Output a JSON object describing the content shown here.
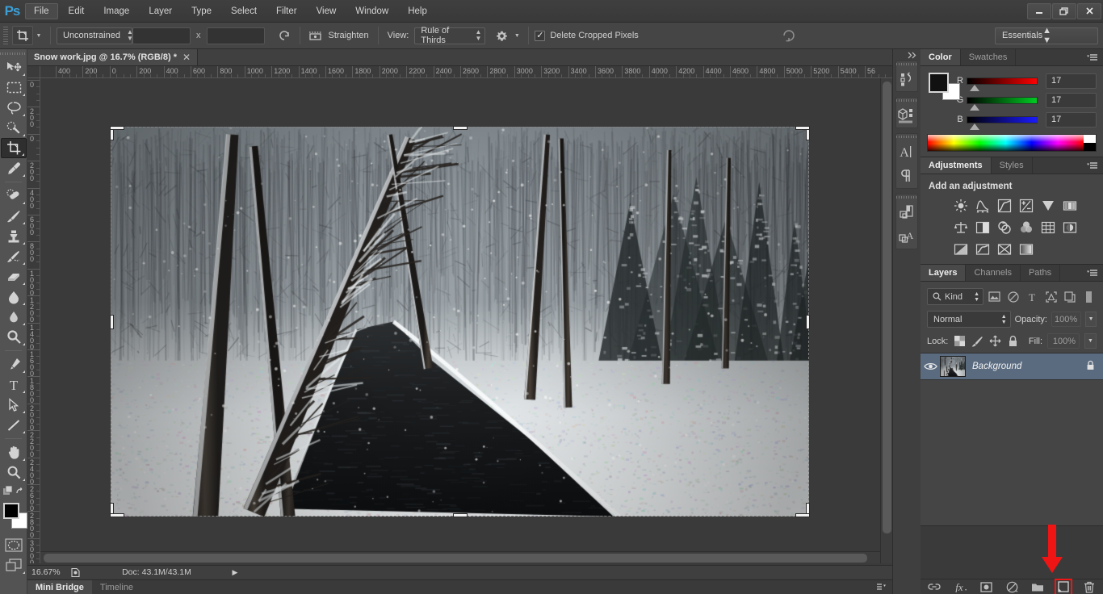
{
  "app": {
    "name": "Ps",
    "logo_color": "#3c9fd6"
  },
  "titlebar": {
    "menus": [
      "File",
      "Edit",
      "Image",
      "Layer",
      "Type",
      "Select",
      "Filter",
      "View",
      "Window",
      "Help"
    ],
    "active_menu": "File",
    "window_buttons": {
      "minimize": "—",
      "restore": "❐",
      "close": "✕"
    }
  },
  "options_bar": {
    "tool_icon": "crop-tool-icon",
    "ratio_preset": "Unconstrained",
    "width_value": "",
    "height_value": "",
    "swap_icon": "swap-arrows-icon",
    "straighten_icon": "straighten-icon",
    "straighten_label": "Straighten",
    "view_label": "View:",
    "overlay_preset": "Rule of Thirds",
    "settings_icon": "gear-icon",
    "delete_cropped_label": "Delete Cropped Pixels",
    "delete_cropped_checked": "✓",
    "reset_icon": "reset-icon",
    "workspace": "Essentials"
  },
  "toolbar": {
    "tools": [
      {
        "name": "move-tool",
        "selected": false
      },
      {
        "name": "rectangular-marquee-tool",
        "selected": false
      },
      {
        "name": "lasso-tool",
        "selected": false
      },
      {
        "name": "quick-selection-tool",
        "selected": false
      },
      {
        "name": "crop-tool",
        "selected": true
      },
      {
        "name": "eyedropper-tool",
        "selected": false
      },
      {
        "name": "spot-healing-brush-tool",
        "selected": false
      },
      {
        "name": "brush-tool",
        "selected": false
      },
      {
        "name": "clone-stamp-tool",
        "selected": false
      },
      {
        "name": "history-brush-tool",
        "selected": false
      },
      {
        "name": "eraser-tool",
        "selected": false
      },
      {
        "name": "gradient-tool",
        "selected": false
      },
      {
        "name": "blur-tool",
        "selected": false
      },
      {
        "name": "dodge-tool",
        "selected": false
      },
      {
        "name": "pen-tool",
        "selected": false
      },
      {
        "name": "horizontal-type-tool",
        "selected": false
      },
      {
        "name": "path-selection-tool",
        "selected": false
      },
      {
        "name": "line-shape-tool",
        "selected": false
      },
      {
        "name": "hand-tool",
        "selected": false
      },
      {
        "name": "zoom-tool",
        "selected": false
      }
    ],
    "foreground_color": "#000000",
    "background_color": "#ffffff"
  },
  "document": {
    "tab_title": "Snow work.jpg @ 16.7% (RGB/8) *",
    "close_glyph": "✕"
  },
  "rulers": {
    "horizontal_labels": [
      "400",
      "200",
      "0",
      "200",
      "400",
      "600",
      "800",
      "1000",
      "1200",
      "1400",
      "1600",
      "1800",
      "2000",
      "2200",
      "2400",
      "2600",
      "2800",
      "3000",
      "3200",
      "3400",
      "3600",
      "3800",
      "4000",
      "4200",
      "4400",
      "4600",
      "4800",
      "5000",
      "5200",
      "5400",
      "56"
    ],
    "vertical_labels": [
      "0",
      "200",
      "0",
      "200",
      "400",
      "600",
      "800",
      "1000",
      "1200",
      "1400",
      "1600",
      "1800",
      "2000",
      "2200",
      "2400",
      "2600",
      "2800",
      "3000",
      "3"
    ],
    "unit": "px"
  },
  "status_bar": {
    "zoom": "16.67%",
    "doc_icon": "document-icon",
    "doc_size": "Doc: 43.1M/43.1M",
    "arrow": "▶"
  },
  "bottom_tabs": {
    "items": [
      {
        "label": "Mini Bridge",
        "active": true
      },
      {
        "label": "Timeline",
        "active": false
      }
    ],
    "menu_icon": "panel-menu-icon"
  },
  "icon_dock": {
    "collapse_icon": "collapse-to-icons-icon",
    "groups": [
      {
        "icons": [
          "history-icon",
          "actions-icon"
        ]
      },
      {
        "icons": [
          "3d-icon",
          "measurement-log-icon"
        ]
      },
      {
        "icons": [
          "character-icon",
          "paragraph-icon"
        ]
      },
      {
        "icons": [
          "layer-comps-icon",
          "character-styles-icon"
        ]
      }
    ]
  },
  "color_panel": {
    "tabs": [
      {
        "label": "Color",
        "active": true
      },
      {
        "label": "Swatches",
        "active": false
      }
    ],
    "menu_icon": "panel-menu-icon",
    "channels": [
      {
        "label": "R",
        "value": "17",
        "from": "#000000",
        "to": "#ff0000"
      },
      {
        "label": "G",
        "value": "17",
        "from": "#000000",
        "to": "#00cc22"
      },
      {
        "label": "B",
        "value": "17",
        "from": "#000000",
        "to": "#1a1aff"
      }
    ],
    "foreground": "#111111",
    "background": "#ffffff"
  },
  "adjustments_panel": {
    "tabs": [
      {
        "label": "Adjustments",
        "active": true
      },
      {
        "label": "Styles",
        "active": false
      }
    ],
    "menu_icon": "panel-menu-icon",
    "heading": "Add an adjustment",
    "icons": [
      "brightness-contrast-icon",
      "levels-icon",
      "curves-icon",
      "exposure-icon",
      "vibrance-icon",
      "hue-saturation-icon",
      "color-balance-icon",
      "black-white-icon",
      "photo-filter-icon",
      "channel-mixer-icon",
      "color-lookup-icon",
      "invert-icon",
      "posterize-icon",
      "threshold-icon",
      "selective-color-icon",
      "gradient-map-icon"
    ]
  },
  "layers_panel": {
    "tabs": [
      {
        "label": "Layers",
        "active": true
      },
      {
        "label": "Channels",
        "active": false
      },
      {
        "label": "Paths",
        "active": false
      }
    ],
    "menu_icon": "panel-menu-icon",
    "filter_label": "Kind",
    "filter_icons": [
      "filter-pixel-icon",
      "filter-adjustment-icon",
      "filter-type-icon",
      "filter-shape-icon",
      "filter-smart-object-icon",
      "filter-toggle-icon"
    ],
    "blend_mode": "Normal",
    "opacity_label": "Opacity:",
    "opacity_value": "100%",
    "lock_label": "Lock:",
    "lock_icons": [
      "lock-transparent-pixels-icon",
      "lock-image-pixels-icon",
      "lock-position-icon",
      "lock-all-icon"
    ],
    "fill_label": "Fill:",
    "fill_value": "100%",
    "layers": [
      {
        "name": "Background",
        "visible": true,
        "locked": true,
        "selected": true
      }
    ],
    "buttons": [
      {
        "name": "link-layers-button",
        "glyph": "link-icon",
        "highlighted": false
      },
      {
        "name": "layer-style-button",
        "glyph": "fx-icon",
        "highlighted": false
      },
      {
        "name": "layer-mask-button",
        "glyph": "mask-icon",
        "highlighted": false
      },
      {
        "name": "new-fill-adjustment-button",
        "glyph": "half-circle-icon",
        "highlighted": false
      },
      {
        "name": "new-group-button",
        "glyph": "folder-icon",
        "highlighted": false
      },
      {
        "name": "new-layer-button",
        "glyph": "new-layer-icon",
        "highlighted": true
      },
      {
        "name": "delete-layer-button",
        "glyph": "trash-icon",
        "highlighted": false
      }
    ]
  },
  "annotation": {
    "arrow_color": "#f01515",
    "points_at": "new-layer-button"
  },
  "canvas": {
    "image_description": "snow-covered-forest-with-stream",
    "crop_overlay": "rule-of-thirds",
    "crop_active": true
  }
}
